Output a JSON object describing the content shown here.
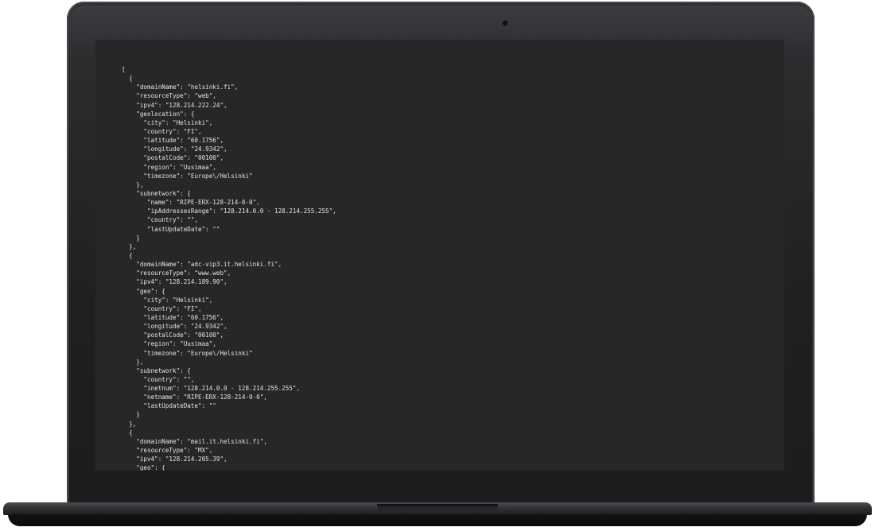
{
  "device": {
    "type": "laptop",
    "screen_background": "#252729",
    "text_color": "#e2e4e6"
  },
  "terminal": {
    "lines": [
      "[",
      "  {",
      "    \"domainName\": \"helsinki.fi\",",
      "    \"resourceType\": \"web\",",
      "    \"ipv4\": \"128.214.222.24\",",
      "    \"geolocation\": {",
      "      \"city\": \"Helsinki\",",
      "      \"country\": \"FI\",",
      "      \"latitude\": \"60.1756\",",
      "      \"longitude\": \"24.9342\",",
      "      \"postalCode\": \"00100\",",
      "      \"region\": \"Uusimaa\",",
      "      \"timezone\": \"Europe\\/Helsinki\"",
      "    },",
      "    \"subnetwork\": {",
      "       \"name\": \"RIPE-ERX-128-214-0-0\",",
      "       \"ipAddressesRange\": \"128.214.0.0 - 128.214.255.255\",",
      "       \"country\": \"\",",
      "       \"lastUpdateDate\": \"\"",
      "    }",
      "  },",
      "  {",
      "    \"domainName\": \"adc-vip3.it.helsinki.fi\",",
      "    \"resourceType\": \"www.web\",",
      "    \"ipv4\": \"128.214.189.90\",",
      "    \"geo\": {",
      "      \"city\": \"Helsinki\",",
      "      \"country\": \"FI\",",
      "      \"latitude\": \"60.1756\",",
      "      \"longitude\": \"24.9342\",",
      "      \"postalCode\": \"00100\",",
      "      \"region\": \"Uusimaa\",",
      "      \"timezone\": \"Europe\\/Helsinki\"",
      "    },",
      "    \"subnetwork\": {",
      "      \"country\": \"\",",
      "      \"inetnum\": \"128.214.0.0 - 128.214.255.255\",",
      "      \"netname\": \"RIPE-ERX-128-214-0-0\",",
      "      \"lastUpdateDate\": \"\"",
      "    }",
      "  },",
      "  {",
      "    \"domainName\": \"mail.it.helsinki.fi\",",
      "    \"resourceType\": \"MX\",",
      "    \"ipv4\": \"128.214.205.39\",",
      "    \"geo\": {"
    ]
  }
}
